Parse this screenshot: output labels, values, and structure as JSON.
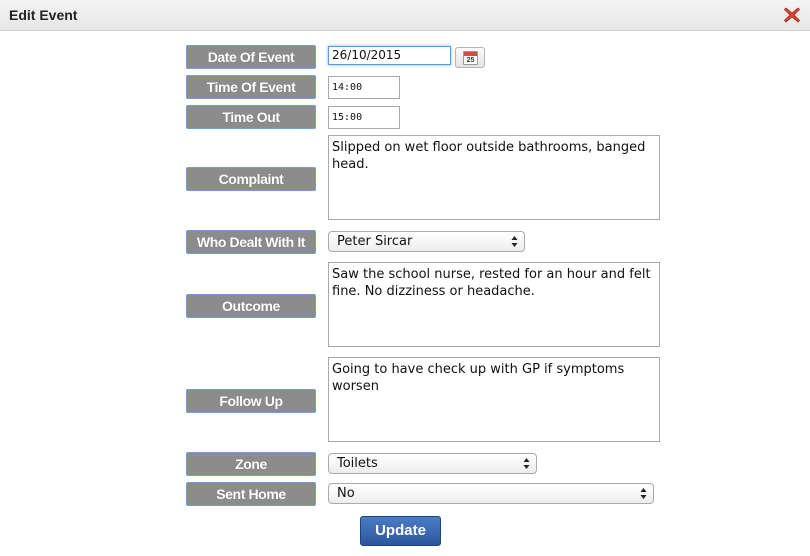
{
  "dialog": {
    "title": "Edit Event",
    "close_icon": "close-x-icon",
    "close_color": "#d9442f"
  },
  "labels": {
    "date": "Date Of Event",
    "time": "Time Of Event",
    "time_out": "Time Out",
    "complaint": "Complaint",
    "dealt": "Who Dealt With It",
    "outcome": "Outcome",
    "follow_up": "Follow Up",
    "zone": "Zone",
    "sent_home": "Sent Home"
  },
  "fields": {
    "date": "26/10/2015",
    "calendar_icon": "calendar-icon",
    "calendar_day": "25",
    "time": "14:00",
    "time_out": "15:00",
    "complaint": "Slipped on wet floor outside bathrooms, banged head.",
    "dealt": "Peter Sircar",
    "outcome": "Saw the school nurse, rested for an hour and felt fine. No dizziness or headache.",
    "follow_up": "Going to have check up with GP if symptoms worsen",
    "zone": "Toilets",
    "sent_home": "No"
  },
  "actions": {
    "update": "Update"
  },
  "colors": {
    "label_bg": "#8c8c8c",
    "label_border": "#6f9ecf",
    "button_bg": "#2f5ea8"
  }
}
